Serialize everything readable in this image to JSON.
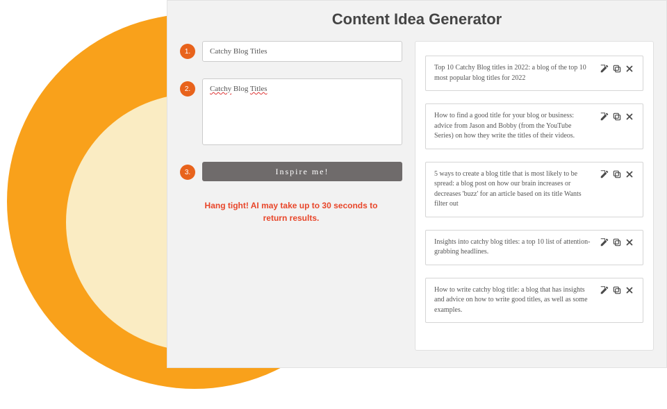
{
  "title": "Content Idea Generator",
  "steps": {
    "one": "1.",
    "two": "2.",
    "three": "3."
  },
  "form": {
    "title_placeholder": "Catchy Blog Titles",
    "title_value": "Catchy Blog Titles",
    "desc_value_1": "Catchy",
    "desc_value_2": "Blog",
    "desc_value_3": "Titles",
    "button_label": "Inspire me!"
  },
  "loading": "Hang tight! AI may take up to 30 seconds to return results.",
  "results": [
    "Top 10 Catchy Blog titles in 2022: a blog of the top 10 most popular blog titles for 2022",
    "How to find a good title for your blog or business: advice from Jason and Bobby (from the YouTube Series) on how they write the titles of their videos.",
    "5 ways to create a blog title that is most likely to be spread: a blog post on how our brain increases or decreases 'buzz' for an article based on its title Wants filter out",
    "Insights into catchy blog titles: a top 10 list of attention-grabbing headlines.",
    "How to write catchy blog title: a blog that has insights and advice on how to write good titles, as well as some examples."
  ]
}
